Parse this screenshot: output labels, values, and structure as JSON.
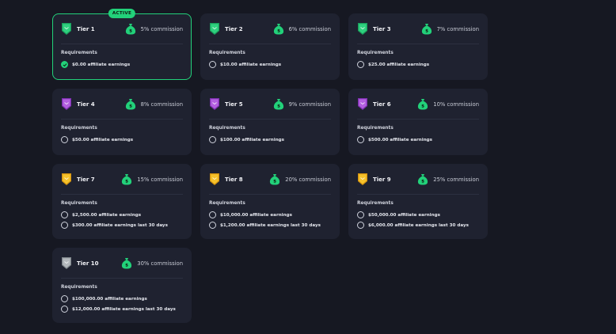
{
  "requirements_title": "Requirements",
  "colors": {
    "accent": "#22d17a",
    "card_bg": "#1f2230",
    "page_bg": "#161822",
    "badge_green": "#2fd17f",
    "badge_purple": "#a64fd4",
    "badge_gold": "#f2b51c",
    "badge_silver": "#9fa4a8"
  },
  "tiers": [
    {
      "name": "Tier 1",
      "commission": "5% commission",
      "badge": "green",
      "active": true,
      "active_label": "ACTIVE",
      "requirements": [
        {
          "text": "$0.00 affiliate earnings",
          "met": true
        }
      ]
    },
    {
      "name": "Tier 2",
      "commission": "6% commission",
      "badge": "green",
      "active": false,
      "requirements": [
        {
          "text": "$10.00 affiliate earnings",
          "met": false
        }
      ]
    },
    {
      "name": "Tier 3",
      "commission": "7% commission",
      "badge": "green",
      "active": false,
      "requirements": [
        {
          "text": "$25.00 affiliate earnings",
          "met": false
        }
      ]
    },
    {
      "name": "Tier 4",
      "commission": "8% commission",
      "badge": "purple",
      "active": false,
      "requirements": [
        {
          "text": "$50.00 affiliate earnings",
          "met": false
        }
      ]
    },
    {
      "name": "Tier 5",
      "commission": "9% commission",
      "badge": "purple",
      "active": false,
      "requirements": [
        {
          "text": "$100.00 affiliate earnings",
          "met": false
        }
      ]
    },
    {
      "name": "Tier 6",
      "commission": "10% commission",
      "badge": "purple",
      "active": false,
      "requirements": [
        {
          "text": "$500.00 affiliate earnings",
          "met": false
        }
      ]
    },
    {
      "name": "Tier 7",
      "commission": "15% commission",
      "badge": "gold",
      "active": false,
      "requirements": [
        {
          "text": "$2,500.00 affiliate earnings",
          "met": false
        },
        {
          "text": "$300.00 affiliate earnings last 30 days",
          "met": false
        }
      ]
    },
    {
      "name": "Tier 8",
      "commission": "20% commission",
      "badge": "gold",
      "active": false,
      "requirements": [
        {
          "text": "$10,000.00 affiliate earnings",
          "met": false
        },
        {
          "text": "$1,200.00 affiliate earnings last 30 days",
          "met": false
        }
      ]
    },
    {
      "name": "Tier 9",
      "commission": "25% commission",
      "badge": "gold",
      "active": false,
      "requirements": [
        {
          "text": "$50,000.00 affiliate earnings",
          "met": false
        },
        {
          "text": "$6,000.00 affiliate earnings last 30 days",
          "met": false
        }
      ]
    },
    {
      "name": "Tier 10",
      "commission": "30% commission",
      "badge": "silver",
      "active": false,
      "requirements": [
        {
          "text": "$100,000.00 affiliate earnings",
          "met": false
        },
        {
          "text": "$12,000.00 affiliate earnings last 30 days",
          "met": false
        }
      ]
    }
  ]
}
